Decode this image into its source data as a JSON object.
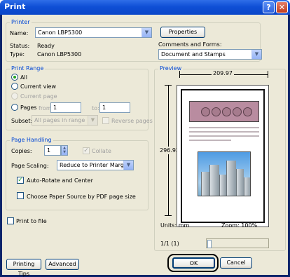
{
  "window": {
    "title": "Print"
  },
  "printer": {
    "group_label": "Printer",
    "name_label": "Name:",
    "name_value": "Canon LBP5300",
    "properties_button": "Properties",
    "status_label": "Status:",
    "status_value": "Ready",
    "type_label": "Type:",
    "type_value": "Canon LBP5300",
    "comments_label": "Comments and Forms:",
    "comments_value": "Document and Stamps"
  },
  "print_range": {
    "group_label": "Print Range",
    "all": "All",
    "current_view": "Current view",
    "current_page": "Current page",
    "pages": "Pages",
    "from_label": "from:",
    "from_value": "1",
    "to_label": "to:",
    "to_value": "1",
    "subset_label": "Subset:",
    "subset_value": "All pages in range",
    "reverse_pages": "Reverse pages"
  },
  "page_handling": {
    "group_label": "Page Handling",
    "copies_label": "Copies:",
    "copies_value": "1",
    "collate": "Collate",
    "scaling_label": "Page Scaling:",
    "scaling_value": "Reduce to Printer Margins",
    "auto_rotate": "Auto-Rotate and Center",
    "choose_source": "Choose Paper Source by PDF page size"
  },
  "print_to_file": "Print to file",
  "preview": {
    "group_label": "Preview",
    "width": "209.97",
    "height": "296.93",
    "units": "Units: mm",
    "zoom": "Zoom: 100%",
    "page_indicator": "1/1 (1)"
  },
  "buttons": {
    "printing_tips": "Printing Tips",
    "advanced": "Advanced",
    "ok": "OK",
    "cancel": "Cancel"
  },
  "title_buttons": {
    "help": "?",
    "close": "✕"
  }
}
